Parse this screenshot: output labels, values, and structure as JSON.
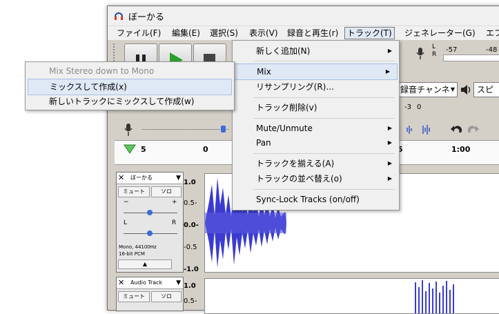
{
  "window": {
    "title": "ぼーかる"
  },
  "menubar": {
    "items": [
      "ファイル(F)",
      "編集(E)",
      "選択(S)",
      "表示(V)",
      "録音と再生(r)",
      "トラック(T)",
      "ジェネレーター(G)",
      "エフ"
    ]
  },
  "meter": {
    "left_letter": "L",
    "right_letter": "R",
    "value_a": "-57",
    "value_b": "-48"
  },
  "device": {
    "channel_label": "録音チャンネ",
    "speaker_label": "スピ"
  },
  "playback": {
    "value_a": "-3",
    "value_b": "0"
  },
  "timeline": {
    "start": "5",
    "zero": "0",
    "five": "5",
    "one_min": "1:00"
  },
  "track_menu": {
    "items": [
      {
        "label": "新しく追加(N)",
        "submenu": true
      },
      {
        "label": "Mix",
        "submenu": true
      },
      {
        "label": "リサンプリング(R)...",
        "submenu": false
      },
      {
        "label": "トラック削除(v)",
        "submenu": false
      },
      {
        "label": "Mute/Unmute",
        "submenu": true
      },
      {
        "label": "Pan",
        "submenu": true
      },
      {
        "label": "トラックを揃える(A)",
        "submenu": true
      },
      {
        "label": "トラックの並べ替え(o)",
        "submenu": true
      },
      {
        "label": "Sync-Lock Tracks (on/off)",
        "submenu": false
      }
    ]
  },
  "mix_submenu": {
    "items": [
      {
        "label": "Mix Stereo down to Mono",
        "disabled": true
      },
      {
        "label": "ミックスして作成(x)",
        "disabled": false
      },
      {
        "label": "新しいトラックにミックスして作成(w)",
        "disabled": false
      }
    ]
  },
  "track1": {
    "name": "ぼーかる",
    "mute": "ミュート",
    "solo": "ソロ",
    "gain_minus": "−",
    "gain_plus": "+",
    "pan_l": "L",
    "pan_r": "R",
    "info_line1": "Mono, 44100Hz",
    "info_line2": "16-bit PCM",
    "scale": [
      "1.0",
      "0.5-",
      "0.0-",
      "-0.5",
      "-1.0"
    ]
  },
  "track2": {
    "name": "Audio Track",
    "mute": "ミュート",
    "solo": "ソロ",
    "scale": [
      "1.0",
      "0.5-"
    ]
  },
  "colors": {
    "waveform": "#3b3bd0",
    "menu_highlight": "#dfe8f5"
  }
}
